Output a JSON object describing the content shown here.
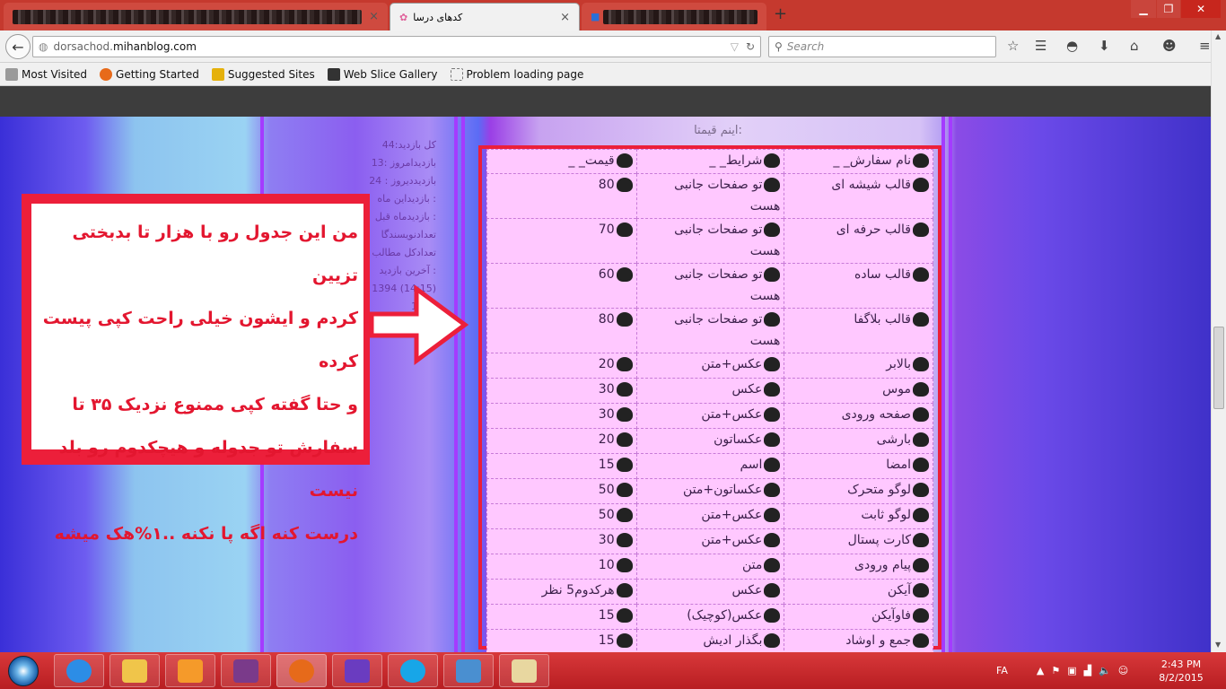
{
  "browser": {
    "active_tab_title": "کدهای درسا",
    "url_prefix": "dorsachod.",
    "url_domain": "mihanblog.com",
    "search_placeholder": "Search",
    "bookmarks": [
      "Most Visited",
      "Getting Started",
      "Suggested Sites",
      "Web Slice Gallery",
      "Problem loading page"
    ],
    "tab_close": "×",
    "new_tab": "+"
  },
  "page": {
    "price_heading": "اینم قیمتا:",
    "stats": [
      "کل بازدید:44",
      "بازدیدامروز :13",
      "بازدیددیروز : 24",
      "بازدیداین ماه :",
      "بازدیدماه قبل :",
      "تعدادنویسندگا",
      "تعدادکل مطالب",
      "آخرین بازدید :",
      "1394 (14:15)",
      "1394"
    ],
    "table": {
      "headers": [
        "نام سفارش_ _",
        "شرایط_ _",
        "قیمت_ _"
      ],
      "rows": [
        [
          "قالب شیشه ای",
          "تو صفحات جانبی هست",
          "80"
        ],
        [
          "قالب حرفه ای",
          "تو صفحات جانبی هست",
          "70"
        ],
        [
          "قالب ساده",
          "تو صفحات جانبی هست",
          "60"
        ],
        [
          "قالب بلاگفا",
          "تو صفحات جانبی هست",
          "80"
        ],
        [
          "بالابر",
          "عکس+متن",
          "20"
        ],
        [
          "موس",
          "عکس",
          "30"
        ],
        [
          "صفحه ورودی",
          "عکس+متن",
          "30"
        ],
        [
          "بارشی",
          "عکساتون",
          "20"
        ],
        [
          "امضا",
          "اسم",
          "15"
        ],
        [
          "لوگو متحرک",
          "عکساتون+متن",
          "50"
        ],
        [
          "لوگو ثابت",
          "عکس+متن",
          "50"
        ],
        [
          "کارت پستال",
          "عکس+متن",
          "30"
        ],
        [
          "پیام ورودی",
          "متن",
          "10"
        ],
        [
          "آیکن",
          "عکس",
          "هرکدوم5 نظر"
        ],
        [
          "فاوآیکن",
          "عکس(کوچیک)",
          "15"
        ],
        [
          "جمع و اوشاد",
          "بگذار ادیش",
          "15"
        ]
      ]
    },
    "note_lines": [
      "من این جدول رو با هزار تا بدبختی تزیین",
      "کردم و ایشون خیلی راحت کپی پیست کرده",
      "و حتا گفته کپی ممنوع نزدیک ۳۵ تا",
      "سفارش تو جدوله و هیچکدوم رو بلد نیست",
      "درست کنه اگه پا نکنه ..۱%هک میشه"
    ]
  },
  "taskbar": {
    "lang": "FA",
    "time": "2:43 PM",
    "date": "8/2/2015"
  }
}
